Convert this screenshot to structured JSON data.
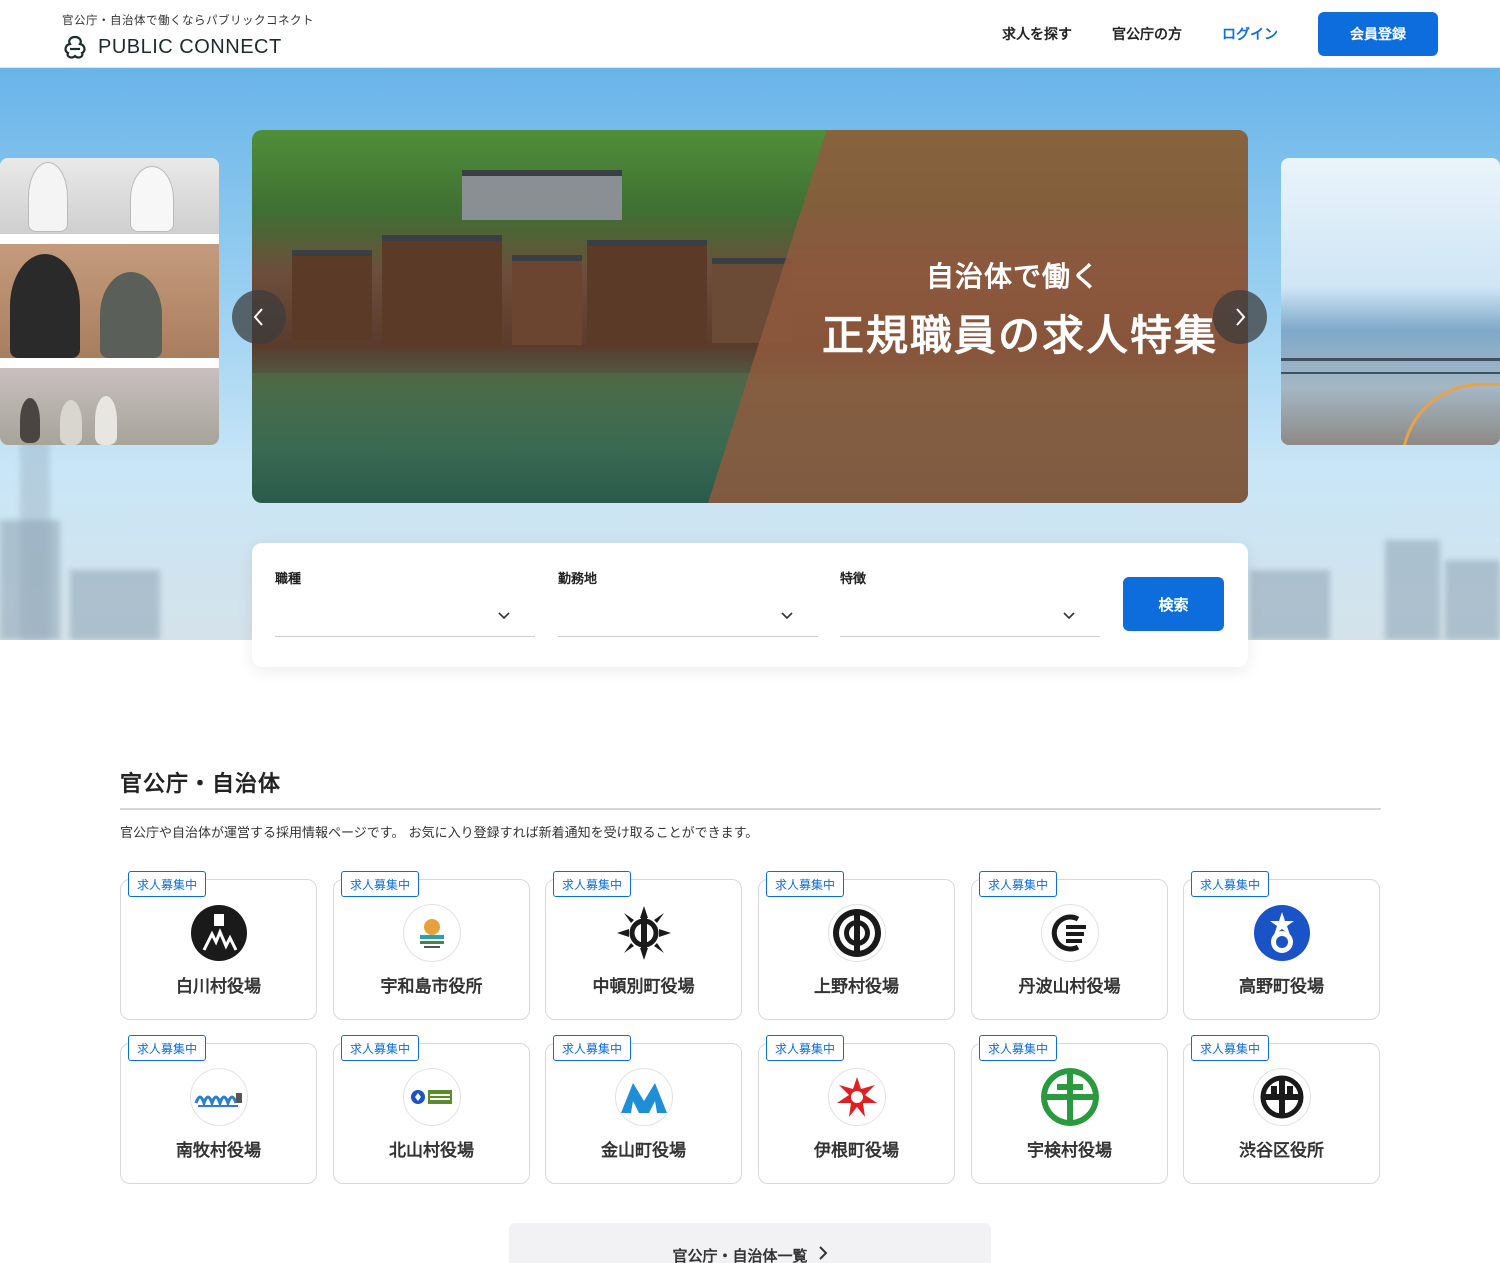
{
  "header": {
    "tagline": "官公庁・自治体で働くならパブリックコネクト",
    "logo_text": "PUBLIC CONNECT",
    "nav": {
      "find_jobs": "求人を探す",
      "for_government": "官公庁の方",
      "login": "ログイン",
      "register": "会員登録"
    }
  },
  "hero": {
    "banner_subtitle": "自治体で働く",
    "banner_title": "正規職員の求人特集"
  },
  "search": {
    "fields": [
      {
        "label": "職種",
        "value": ""
      },
      {
        "label": "勤務地",
        "value": ""
      },
      {
        "label": "特徴",
        "value": ""
      }
    ],
    "button": "検索"
  },
  "section": {
    "title": "官公庁・自治体",
    "description": "官公庁や自治体が運営する採用情報ページです。 お気に入り登録すれば新着通知を受け取ることができます。",
    "badge": "求人募集中",
    "cards": [
      {
        "name": "白川村役場",
        "icon": "shirakawa-emblem-icon"
      },
      {
        "name": "宇和島市役所",
        "icon": "uwajima-emblem-icon"
      },
      {
        "name": "中頓別町役場",
        "icon": "nakatonbetsu-emblem-icon"
      },
      {
        "name": "上野村役場",
        "icon": "ueno-emblem-icon"
      },
      {
        "name": "丹波山村役場",
        "icon": "tabayama-emblem-icon"
      },
      {
        "name": "高野町役場",
        "icon": "koya-emblem-icon"
      },
      {
        "name": "南牧村役場",
        "icon": "minamimaki-emblem-icon"
      },
      {
        "name": "北山村役場",
        "icon": "kitayama-emblem-icon"
      },
      {
        "name": "金山町役場",
        "icon": "kaneyama-emblem-icon"
      },
      {
        "name": "伊根町役場",
        "icon": "ine-emblem-icon"
      },
      {
        "name": "宇検村役場",
        "icon": "uken-emblem-icon"
      },
      {
        "name": "渋谷区役所",
        "icon": "shibuya-emblem-icon"
      }
    ],
    "more_button": "官公庁・自治体一覧"
  },
  "colors": {
    "accent": "#0e6ddc",
    "banner_overlay": "#925a3e"
  }
}
